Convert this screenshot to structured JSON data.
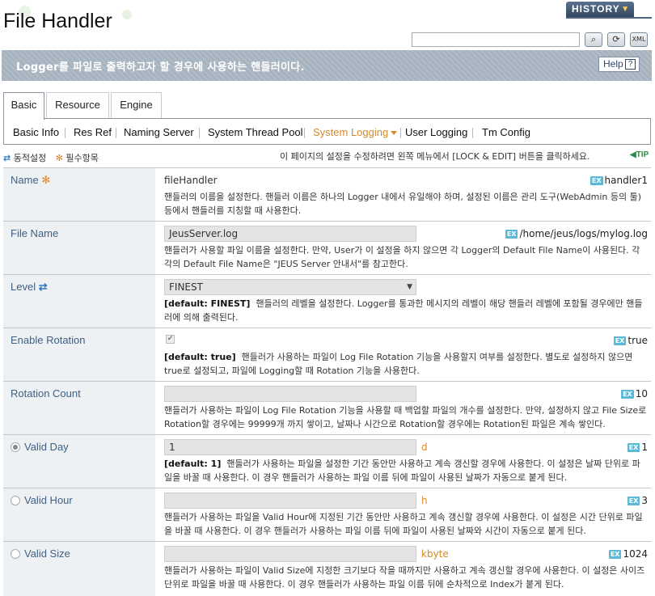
{
  "header": {
    "title": "File Handler",
    "history_label": "HISTORY"
  },
  "search": {
    "placeholder": ""
  },
  "banner": {
    "text": "Logger를 파일로 출력하고자 할 경우에 사용하는 핸들러이다.",
    "help_label": "Help",
    "help_icon": "?"
  },
  "tabs": [
    {
      "label": "Basic",
      "active": true
    },
    {
      "label": "Resource"
    },
    {
      "label": "Engine"
    }
  ],
  "subnav": [
    {
      "label": "Basic Info"
    },
    {
      "label": "Res Ref"
    },
    {
      "label": "Naming Server"
    },
    {
      "label": "System Thread Pool"
    },
    {
      "label": "System Logging",
      "active": true
    },
    {
      "label": "User Logging"
    },
    {
      "label": "Tm Config"
    }
  ],
  "legend": {
    "dynamic": "동적설정",
    "required": "필수항목"
  },
  "notice": "이 페이지의 설정을 수정하려면 왼쪽 메뉴에서 [LOCK & EDIT] 버튼을 클릭하세요.",
  "tip": "TIP",
  "ex_badge": "EX",
  "rows": {
    "name": {
      "label": "Name",
      "value": "fileHandler",
      "example": "handler1",
      "desc": "핸들러의 이름을 설정한다. 핸들러 이름은 하나의 Logger 내에서 유일해야 하며, 설정된 이름은 관리 도구(WebAdmin 등의 툴) 등에서 핸들러를 지칭할 때 사용한다."
    },
    "file_name": {
      "label": "File Name",
      "value": "JeusServer.log",
      "example": "/home/jeus/logs/mylog.log",
      "desc": "핸들러가 사용할 파일 이름을 설정한다. 만약, User가 이 설정을 하지 않으면 각 Logger의 Default File Name이 사용된다. 각각의 Default File Name은 \"JEUS Server 안내서\"를 참고한다."
    },
    "level": {
      "label": "Level",
      "value": "FINEST",
      "default": "[default: FINEST]",
      "desc": "핸들러의 레벨을 설정한다. Logger를 통과한 메시지의 레벨이 해당 핸들러 레벨에 포함될 경우에만 핸들러에 의해 출력된다."
    },
    "enable_rotation": {
      "label": "Enable Rotation",
      "checked": true,
      "example": "true",
      "default": "[default: true]",
      "desc": "핸들러가 사용하는 파일이 Log File Rotation 기능을 사용할지 여부를 설정한다. 별도로 설정하지 않으면 true로 설정되고, 파일에 Logging할 때 Rotation 기능을 사용한다."
    },
    "rotation_count": {
      "label": "Rotation Count",
      "value": "",
      "example": "10",
      "desc": "핸들러가 사용하는 파일이 Log File Rotation 기능을 사용할 때 백업할 파일의 개수를 설정한다. 만약, 설정하지 않고 File Size로 Rotation할 경우에는 99999개 까지 쌓이고, 날짜나 시간으로 Rotation할 경우에는 Rotation된 파일은 계속 쌓인다."
    },
    "valid_day": {
      "label": "Valid Day",
      "value": "1",
      "unit": "d",
      "example": "1",
      "default": "[default: 1]",
      "selected": true,
      "desc": "핸들러가 사용하는 파일을 설정한 기간 동안만 사용하고 계속 갱신할 경우에 사용한다. 이 설정은 날짜 단위로 파일을 바꿀 때 사용한다. 이 경우 핸들러가 사용하는 파일 이름 뒤에 파일이 사용된 날짜가 자동으로 붙게 된다."
    },
    "valid_hour": {
      "label": "Valid Hour",
      "value": "",
      "unit": "h",
      "example": "3",
      "desc": "핸들러가 사용하는 파일을 Valid Hour에 지정된 기간 동안만 사용하고 계속 갱신할 경우에 사용한다. 이 설정은 시간 단위로 파일을 바꿀 때 사용한다. 이 경우 핸들러가 사용하는 파일 이름 뒤에 파일이 사용된 날짜와 시간이 자동으로 붙게 된다."
    },
    "valid_size": {
      "label": "Valid Size",
      "value": "",
      "unit": "kbyte",
      "example": "1024",
      "desc": "핸들러가 사용하는 파일이 Valid Size에 지정한 크기보다 작을 때까지만 사용하고 계속 갱신할 경우에 사용한다. 이 설정은 사이즈 단위로 파일을 바꿀 때 사용한다. 이 경우 핸들러가 사용하는 파일 이름 뒤에 순차적으로 Index가 붙게 된다."
    }
  }
}
